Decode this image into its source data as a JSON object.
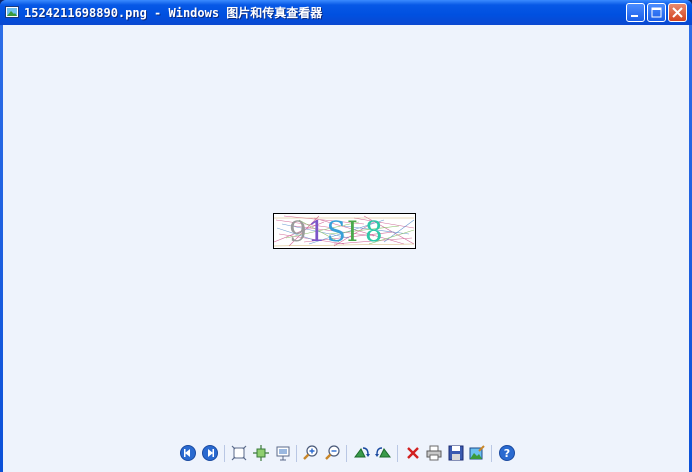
{
  "window": {
    "title": "1524211698890.png - Windows 图片和传真查看器"
  },
  "image": {
    "captcha_text": "91SI8",
    "characters": [
      {
        "char": "9",
        "color": "#9b9b9b"
      },
      {
        "char": "1",
        "color": "#7a55c8"
      },
      {
        "char": "S",
        "color": "#38a0d8"
      },
      {
        "char": "I",
        "color": "#4aa84a"
      },
      {
        "char": "8",
        "color": "#2ec8a8"
      }
    ]
  },
  "toolbar": {
    "buttons": [
      "previous-image",
      "next-image",
      "best-fit",
      "actual-size",
      "slideshow",
      "zoom-in",
      "zoom-out",
      "rotate-clockwise",
      "rotate-counterclockwise",
      "delete",
      "print",
      "copy-to",
      "open-for-editing",
      "help"
    ]
  },
  "colors": {
    "titlebar": "#0050e0",
    "client_background": "#eef3fc",
    "close_button": "#d3431f"
  }
}
